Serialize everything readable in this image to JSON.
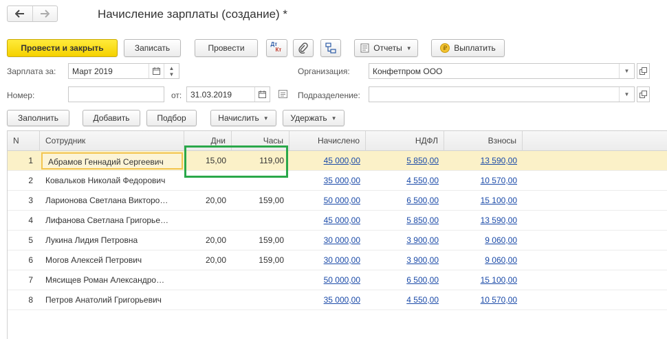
{
  "window": {
    "title": "Начисление зарплаты (создание) *"
  },
  "nav": {
    "back_icon": "arrow-left-icon",
    "forward_icon": "arrow-right-icon"
  },
  "toolbar": {
    "post_close": "Провести и закрыть",
    "save": "Записать",
    "post": "Провести",
    "dtkt_dt": "Дт",
    "dtkt_kt": "Кт",
    "reports": "Отчеты",
    "pay": "Выплатить"
  },
  "form": {
    "salary_for_label": "Зарплата за:",
    "salary_for_value": "Март 2019",
    "number_label": "Номер:",
    "number_value": "",
    "date_label": "от:",
    "date_value": "31.03.2019",
    "org_label": "Организация:",
    "org_value": "Конфетпром ООО",
    "dept_label": "Подразделение:",
    "dept_value": ""
  },
  "table_toolbar": {
    "fill": "Заполнить",
    "add": "Добавить",
    "pick": "Подбор",
    "accrue": "Начислить",
    "withhold": "Удержать"
  },
  "table": {
    "headers": [
      "N",
      "Сотрудник",
      "Дни",
      "Часы",
      "Начислено",
      "НДФЛ",
      "Взносы"
    ],
    "rows": [
      {
        "n": "1",
        "employee": "Абрамов Геннадий Сергеевич",
        "days": "15,00",
        "hours": "119,00",
        "accrued": "45 000,00",
        "ndfl": "5 850,00",
        "contrib": "13 590,00"
      },
      {
        "n": "2",
        "employee": "Ковальков Николай Федорович",
        "days": "",
        "hours": "",
        "accrued": "35 000,00",
        "ndfl": "4 550,00",
        "contrib": "10 570,00"
      },
      {
        "n": "3",
        "employee": "Ларионова Светлана Викторо…",
        "days": "20,00",
        "hours": "159,00",
        "accrued": "50 000,00",
        "ndfl": "6 500,00",
        "contrib": "15 100,00"
      },
      {
        "n": "4",
        "employee": "Лифанова Светлана Григорье…",
        "days": "",
        "hours": "",
        "accrued": "45 000,00",
        "ndfl": "5 850,00",
        "contrib": "13 590,00"
      },
      {
        "n": "5",
        "employee": "Лукина Лидия Петровна",
        "days": "20,00",
        "hours": "159,00",
        "accrued": "30 000,00",
        "ndfl": "3 900,00",
        "contrib": "9 060,00"
      },
      {
        "n": "6",
        "employee": "Могов Алексей Петрович",
        "days": "20,00",
        "hours": "159,00",
        "accrued": "30 000,00",
        "ndfl": "3 900,00",
        "contrib": "9 060,00"
      },
      {
        "n": "7",
        "employee": "Мясищев Роман Александро…",
        "days": "",
        "hours": "",
        "accrued": "50 000,00",
        "ndfl": "6 500,00",
        "contrib": "15 100,00"
      },
      {
        "n": "8",
        "employee": "Петров Анатолий Григорьевич",
        "days": "",
        "hours": "",
        "accrued": "35 000,00",
        "ndfl": "4 550,00",
        "contrib": "10 570,00"
      }
    ]
  },
  "colors": {
    "primary_button": "#f5d100",
    "selected_row": "#fbf1c8",
    "link": "#1a4aa8",
    "highlight_box": "#2aa84a"
  }
}
